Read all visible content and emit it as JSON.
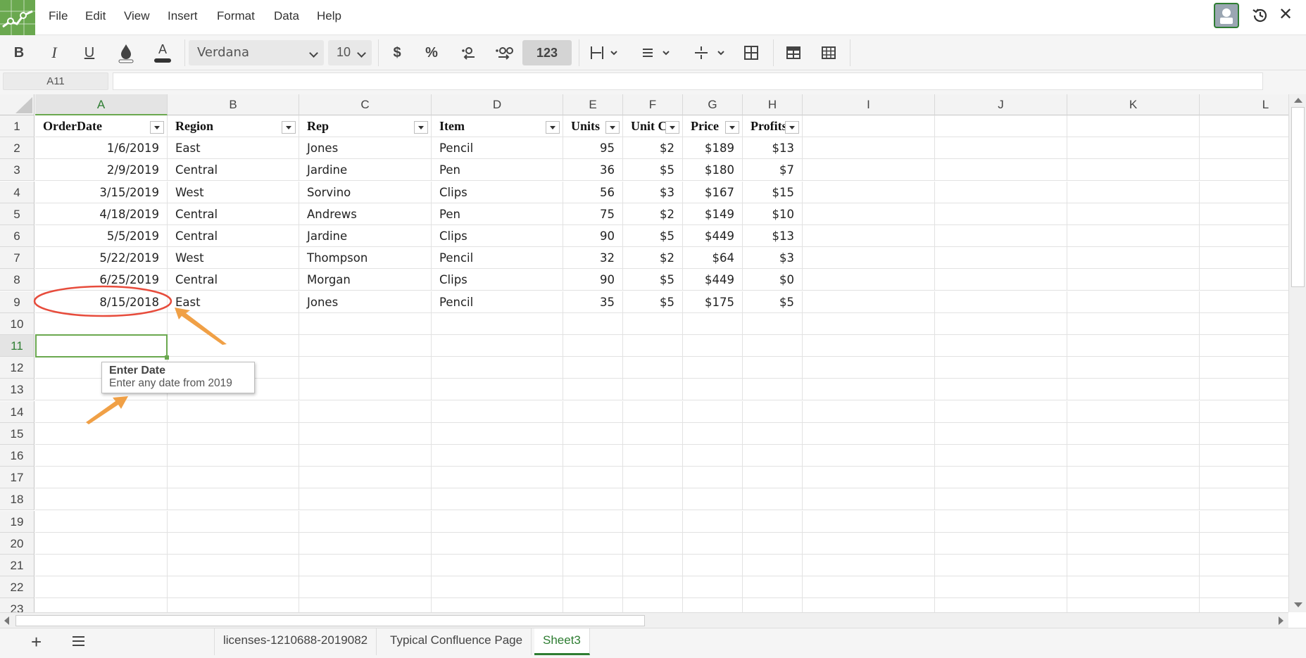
{
  "menu": [
    "File",
    "Edit",
    "View",
    "Insert",
    "Format",
    "Data",
    "Help"
  ],
  "toolbar": {
    "bold": "B",
    "italic": "I",
    "underline": "U",
    "text_color": "A",
    "font": "Verdana",
    "size": "10",
    "currency": "$",
    "percent": "%",
    "number_format": "123"
  },
  "namebox": "A11",
  "columns": [
    "A",
    "B",
    "C",
    "D",
    "E",
    "F",
    "G",
    "H",
    "I",
    "J",
    "K",
    "L"
  ],
  "rows": [
    "1",
    "2",
    "3",
    "4",
    "5",
    "6",
    "7",
    "8",
    "9",
    "10",
    "11",
    "12",
    "13",
    "14",
    "15",
    "16",
    "17",
    "18",
    "19",
    "20",
    "21",
    "22",
    "23"
  ],
  "headers": [
    "OrderDate",
    "Region",
    "Rep",
    "Item",
    "Units",
    "Unit C",
    "Price",
    "Profits"
  ],
  "table": [
    [
      "1/6/2019",
      "East",
      "Jones",
      "Pencil",
      "95",
      "$2",
      "$189",
      "$13"
    ],
    [
      "2/9/2019",
      "Central",
      "Jardine",
      "Pen",
      "36",
      "$5",
      "$180",
      "$7"
    ],
    [
      "3/15/2019",
      "West",
      "Sorvino",
      "Clips",
      "56",
      "$3",
      "$167",
      "$15"
    ],
    [
      "4/18/2019",
      "Central",
      "Andrews",
      "Pen",
      "75",
      "$2",
      "$149",
      "$10"
    ],
    [
      "5/5/2019",
      "Central",
      "Jardine",
      "Clips",
      "90",
      "$5",
      "$449",
      "$13"
    ],
    [
      "5/22/2019",
      "West",
      "Thompson",
      "Pencil",
      "32",
      "$2",
      "$64",
      "$3"
    ],
    [
      "6/25/2019",
      "Central",
      "Morgan",
      "Clips",
      "90",
      "$5",
      "$449",
      "$0"
    ],
    [
      "8/15/2018",
      "East",
      "Jones",
      "Pencil",
      "35",
      "$5",
      "$175",
      "$5"
    ]
  ],
  "tooltip": {
    "title": "Enter Date",
    "body": "Enter any date from 2019"
  },
  "sheets": [
    "licenses-1210688-2019082",
    "Typical Confluence Page",
    "Sheet3"
  ],
  "active_sheet": "Sheet3",
  "colors": {
    "accent": "#2e7d32",
    "logo": "#6aa84f",
    "annotation_circle": "#e74c3c",
    "annotation_arrow": "#f0a046"
  }
}
